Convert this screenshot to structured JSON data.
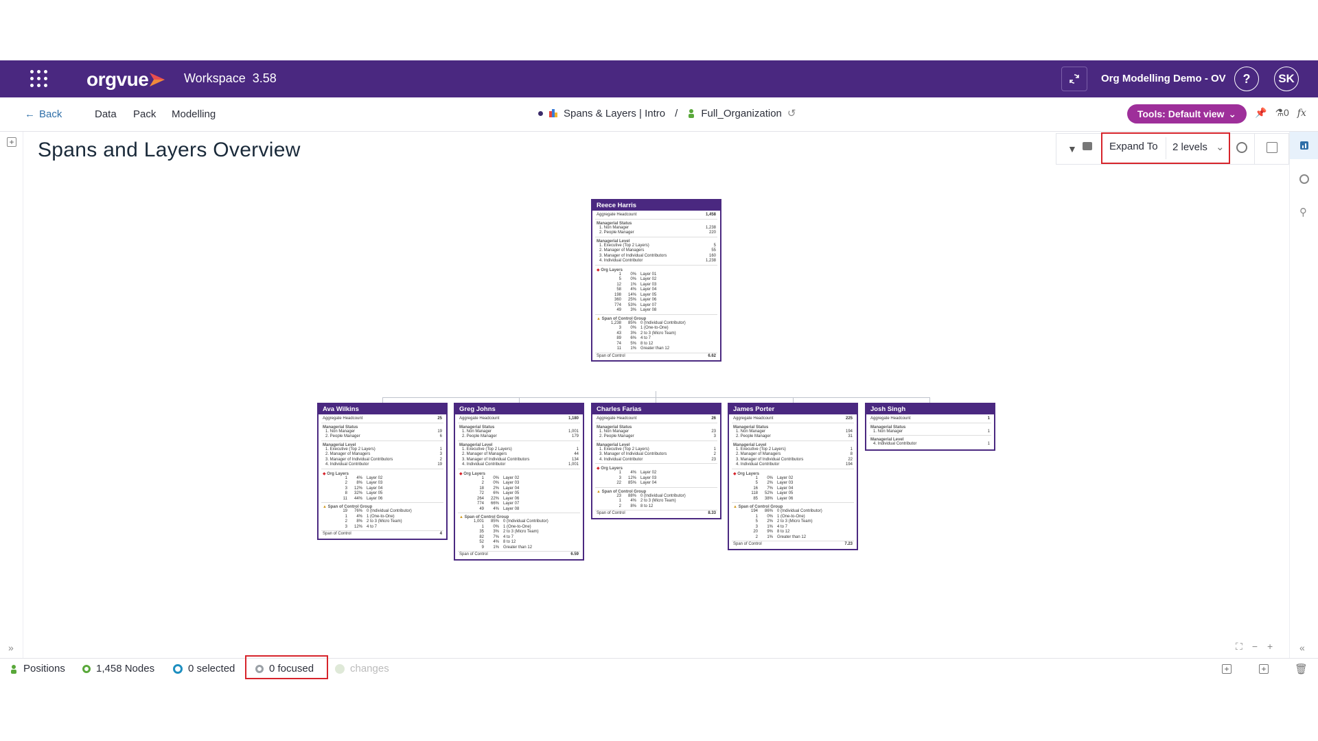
{
  "header": {
    "logo_text": "orgvue",
    "workspace_label": "Workspace",
    "version": "3.58",
    "org_name": "Org Modelling Demo - OV",
    "help_label": "?",
    "avatar_initials": "SK",
    "accent_color": "#4a2880"
  },
  "nav": {
    "back_label": "Back",
    "items": [
      "Data",
      "Pack",
      "Modelling"
    ],
    "breadcrumb_pack": "Spans & Layers | Intro",
    "breadcrumb_sep": "/",
    "breadcrumb_dataset": "Full_Organization",
    "tools_label": "Tools: Default view",
    "flag_count": "0",
    "fx_label": "fx"
  },
  "page": {
    "title": "Spans and Layers Overview"
  },
  "toolbar": {
    "expand_label": "Expand To",
    "expand_value": "2 levels"
  },
  "cards": {
    "root": {
      "name": "Reece Harris",
      "headcount_label": "Aggregate Headcount",
      "headcount": "1,458",
      "status_label": "Managerial Status",
      "status": [
        [
          "1. Non Manager",
          "1,238"
        ],
        [
          "2. People Manager",
          "220"
        ]
      ],
      "level_label": "Managerial Level",
      "levels": [
        [
          "1. Executive (Top 2 Layers)",
          "5"
        ],
        [
          "2. Manager of Managers",
          "55"
        ],
        [
          "3. Manager of Individual Contributors",
          "160"
        ],
        [
          "4. Individual Contributor",
          "1,238"
        ]
      ],
      "layers_label": "Org Layers",
      "layers": [
        [
          "1",
          "0%",
          "Layer 01"
        ],
        [
          "5",
          "0%",
          "Layer 02"
        ],
        [
          "12",
          "1%",
          "Layer 03"
        ],
        [
          "58",
          "4%",
          "Layer 04"
        ],
        [
          "198",
          "14%",
          "Layer 05"
        ],
        [
          "360",
          "25%",
          "Layer 06"
        ],
        [
          "774",
          "53%",
          "Layer 07"
        ],
        [
          "49",
          "3%",
          "Layer 08"
        ]
      ],
      "span_label": "Span of Control Group",
      "spans": [
        [
          "1,238",
          "85%",
          "0 (Individual Contributor)"
        ],
        [
          "3",
          "0%",
          "1 (One-to-One)"
        ],
        [
          "43",
          "3%",
          "2 to 3 (Micro Team)"
        ],
        [
          "89",
          "6%",
          "4 to 7"
        ],
        [
          "74",
          "5%",
          "8 to 12"
        ],
        [
          "11",
          "1%",
          "Greater than 12"
        ]
      ],
      "soc_label": "Span of Control",
      "soc": "6.62"
    },
    "ava": {
      "name": "Ava Wilkins",
      "headcount": "25",
      "status": [
        [
          "1. Non Manager",
          "19"
        ],
        [
          "2. People Manager",
          "6"
        ]
      ],
      "levels": [
        [
          "1. Executive (Top 2 Layers)",
          "1"
        ],
        [
          "2. Manager of Managers",
          "3"
        ],
        [
          "3. Manager of Individual Contributors",
          "2"
        ],
        [
          "4. Individual Contributor",
          "19"
        ]
      ],
      "layers": [
        [
          "1",
          "4%",
          "Layer 02"
        ],
        [
          "2",
          "8%",
          "Layer 03"
        ],
        [
          "3",
          "12%",
          "Layer 04"
        ],
        [
          "8",
          "32%",
          "Layer 05"
        ],
        [
          "11",
          "44%",
          "Layer 06"
        ]
      ],
      "spans": [
        [
          "19",
          "76%",
          "0 (Individual Contributor)"
        ],
        [
          "1",
          "4%",
          "1 (One-to-One)"
        ],
        [
          "2",
          "8%",
          "2 to 3 (Micro Team)"
        ],
        [
          "3",
          "12%",
          "4 to 7"
        ]
      ],
      "soc": "4"
    },
    "greg": {
      "name": "Greg Johns",
      "headcount": "1,180",
      "status": [
        [
          "1. Non Manager",
          "1,001"
        ],
        [
          "2. People Manager",
          "179"
        ]
      ],
      "levels": [
        [
          "1. Executive (Top 2 Layers)",
          "1"
        ],
        [
          "2. Manager of Managers",
          "44"
        ],
        [
          "3. Manager of Individual Contributors",
          "134"
        ],
        [
          "4. Individual Contributor",
          "1,001"
        ]
      ],
      "layers": [
        [
          "1",
          "0%",
          "Layer 02"
        ],
        [
          "2",
          "0%",
          "Layer 03"
        ],
        [
          "18",
          "2%",
          "Layer 04"
        ],
        [
          "72",
          "6%",
          "Layer 05"
        ],
        [
          "264",
          "22%",
          "Layer 06"
        ],
        [
          "774",
          "66%",
          "Layer 07"
        ],
        [
          "49",
          "4%",
          "Layer 08"
        ]
      ],
      "spans": [
        [
          "1,001",
          "85%",
          "0 (Individual Contributor)"
        ],
        [
          "1",
          "0%",
          "1 (One-to-One)"
        ],
        [
          "35",
          "3%",
          "2 to 3 (Micro Team)"
        ],
        [
          "82",
          "7%",
          "4 to 7"
        ],
        [
          "52",
          "4%",
          "8 to 12"
        ],
        [
          "9",
          "1%",
          "Greater than 12"
        ]
      ],
      "soc": "6.59"
    },
    "charles": {
      "name": "Charles Farias",
      "headcount": "26",
      "status": [
        [
          "1. Non Manager",
          "23"
        ],
        [
          "2. People Manager",
          "3"
        ]
      ],
      "levels": [
        [
          "1. Executive (Top 2 Layers)",
          "1"
        ],
        [
          "3. Manager of Individual Contributors",
          "2"
        ],
        [
          "4. Individual Contributor",
          "23"
        ]
      ],
      "layers": [
        [
          "1",
          "4%",
          "Layer 02"
        ],
        [
          "3",
          "12%",
          "Layer 03"
        ],
        [
          "22",
          "85%",
          "Layer 04"
        ]
      ],
      "spans": [
        [
          "23",
          "88%",
          "0 (Individual Contributor)"
        ],
        [
          "1",
          "4%",
          "2 to 3 (Micro Team)"
        ],
        [
          "2",
          "8%",
          "8 to 12"
        ]
      ],
      "soc": "8.33"
    },
    "james": {
      "name": "James Porter",
      "headcount": "225",
      "status": [
        [
          "1. Non Manager",
          "194"
        ],
        [
          "2. People Manager",
          "31"
        ]
      ],
      "levels": [
        [
          "1. Executive (Top 2 Layers)",
          "1"
        ],
        [
          "2. Manager of Managers",
          "8"
        ],
        [
          "3. Manager of Individual Contributors",
          "22"
        ],
        [
          "4. Individual Contributor",
          "194"
        ]
      ],
      "layers": [
        [
          "1",
          "0%",
          "Layer 02"
        ],
        [
          "5",
          "2%",
          "Layer 03"
        ],
        [
          "16",
          "7%",
          "Layer 04"
        ],
        [
          "118",
          "52%",
          "Layer 05"
        ],
        [
          "85",
          "38%",
          "Layer 06"
        ]
      ],
      "spans": [
        [
          "194",
          "86%",
          "0 (Individual Contributor)"
        ],
        [
          "1",
          "0%",
          "1 (One-to-One)"
        ],
        [
          "5",
          "2%",
          "2 to 3 (Micro Team)"
        ],
        [
          "3",
          "1%",
          "4 to 7"
        ],
        [
          "20",
          "9%",
          "8 to 12"
        ],
        [
          "2",
          "1%",
          "Greater than 12"
        ]
      ],
      "soc": "7.23"
    },
    "josh": {
      "name": "Josh Singh",
      "headcount": "1",
      "status": [
        [
          "1. Non Manager",
          "1"
        ]
      ],
      "levels": [
        [
          "4. Individual Contributor",
          "1"
        ]
      ]
    }
  },
  "status": {
    "positions_label": "Positions",
    "nodes": "1,458 Nodes",
    "selected": "0 selected",
    "focused": "0 focused",
    "changes": "changes"
  }
}
